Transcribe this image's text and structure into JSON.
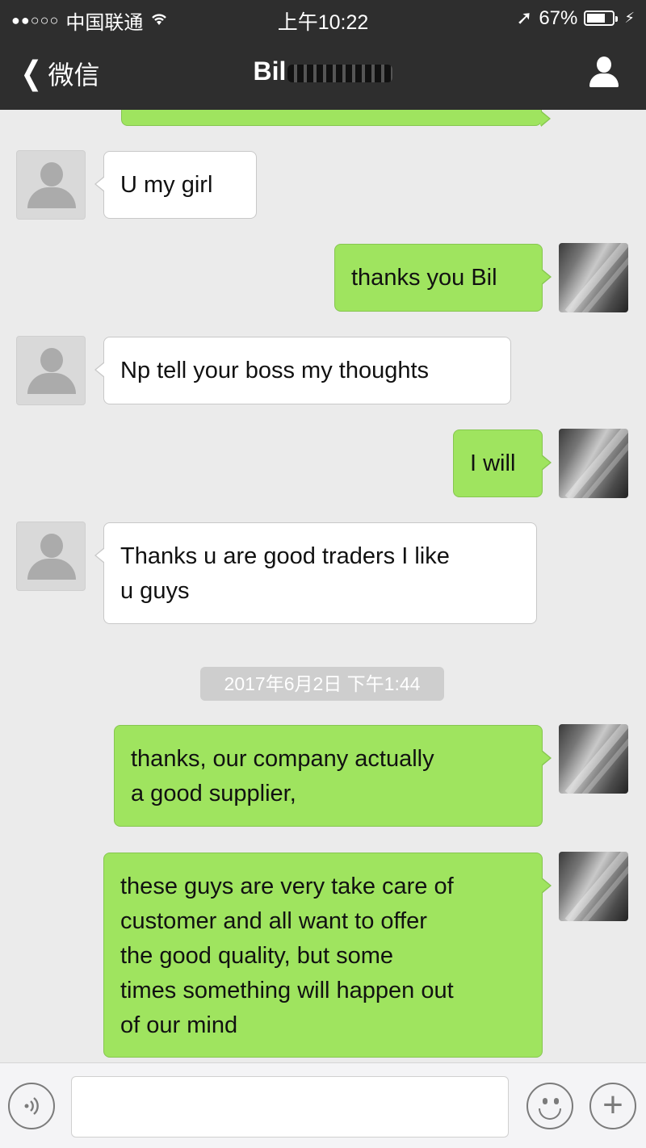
{
  "status_bar": {
    "signal": "●●○○○",
    "carrier": "中国联通",
    "time": "上午10:22",
    "battery": "67%",
    "location_arrow": "➚",
    "charging": "⚡"
  },
  "nav": {
    "back_label": "微信",
    "title": "Bil",
    "title_redacted": true
  },
  "messages": [
    {
      "side": "in",
      "text": "U my  girl"
    },
    {
      "side": "out",
      "text": "thanks you Bil"
    },
    {
      "side": "in",
      "text": "Np tell your boss my thoughts"
    },
    {
      "side": "out",
      "text": "I will"
    },
    {
      "side": "in",
      "text": "Thanks u are good traders I like\nu guys"
    },
    {
      "side": "out",
      "text": "thanks,    our company actually\na good supplier,"
    },
    {
      "side": "out",
      "text": "these guys are very take care of\n customer and all want to offer\nthe good quality, but some\ntimes something will happen out\n of our mind"
    }
  ],
  "timestamp": "2017年6月2日 下午1:44",
  "colors": {
    "header_bg": "#2e2e2e",
    "chat_bg": "#ebebeb",
    "outgoing_bubble": "#9fe45f",
    "incoming_bubble": "#ffffff"
  },
  "icons": [
    "back-chevron-icon",
    "profile-icon",
    "voice-icon",
    "emoji-icon",
    "plus-icon",
    "wifi-icon",
    "battery-icon"
  ]
}
